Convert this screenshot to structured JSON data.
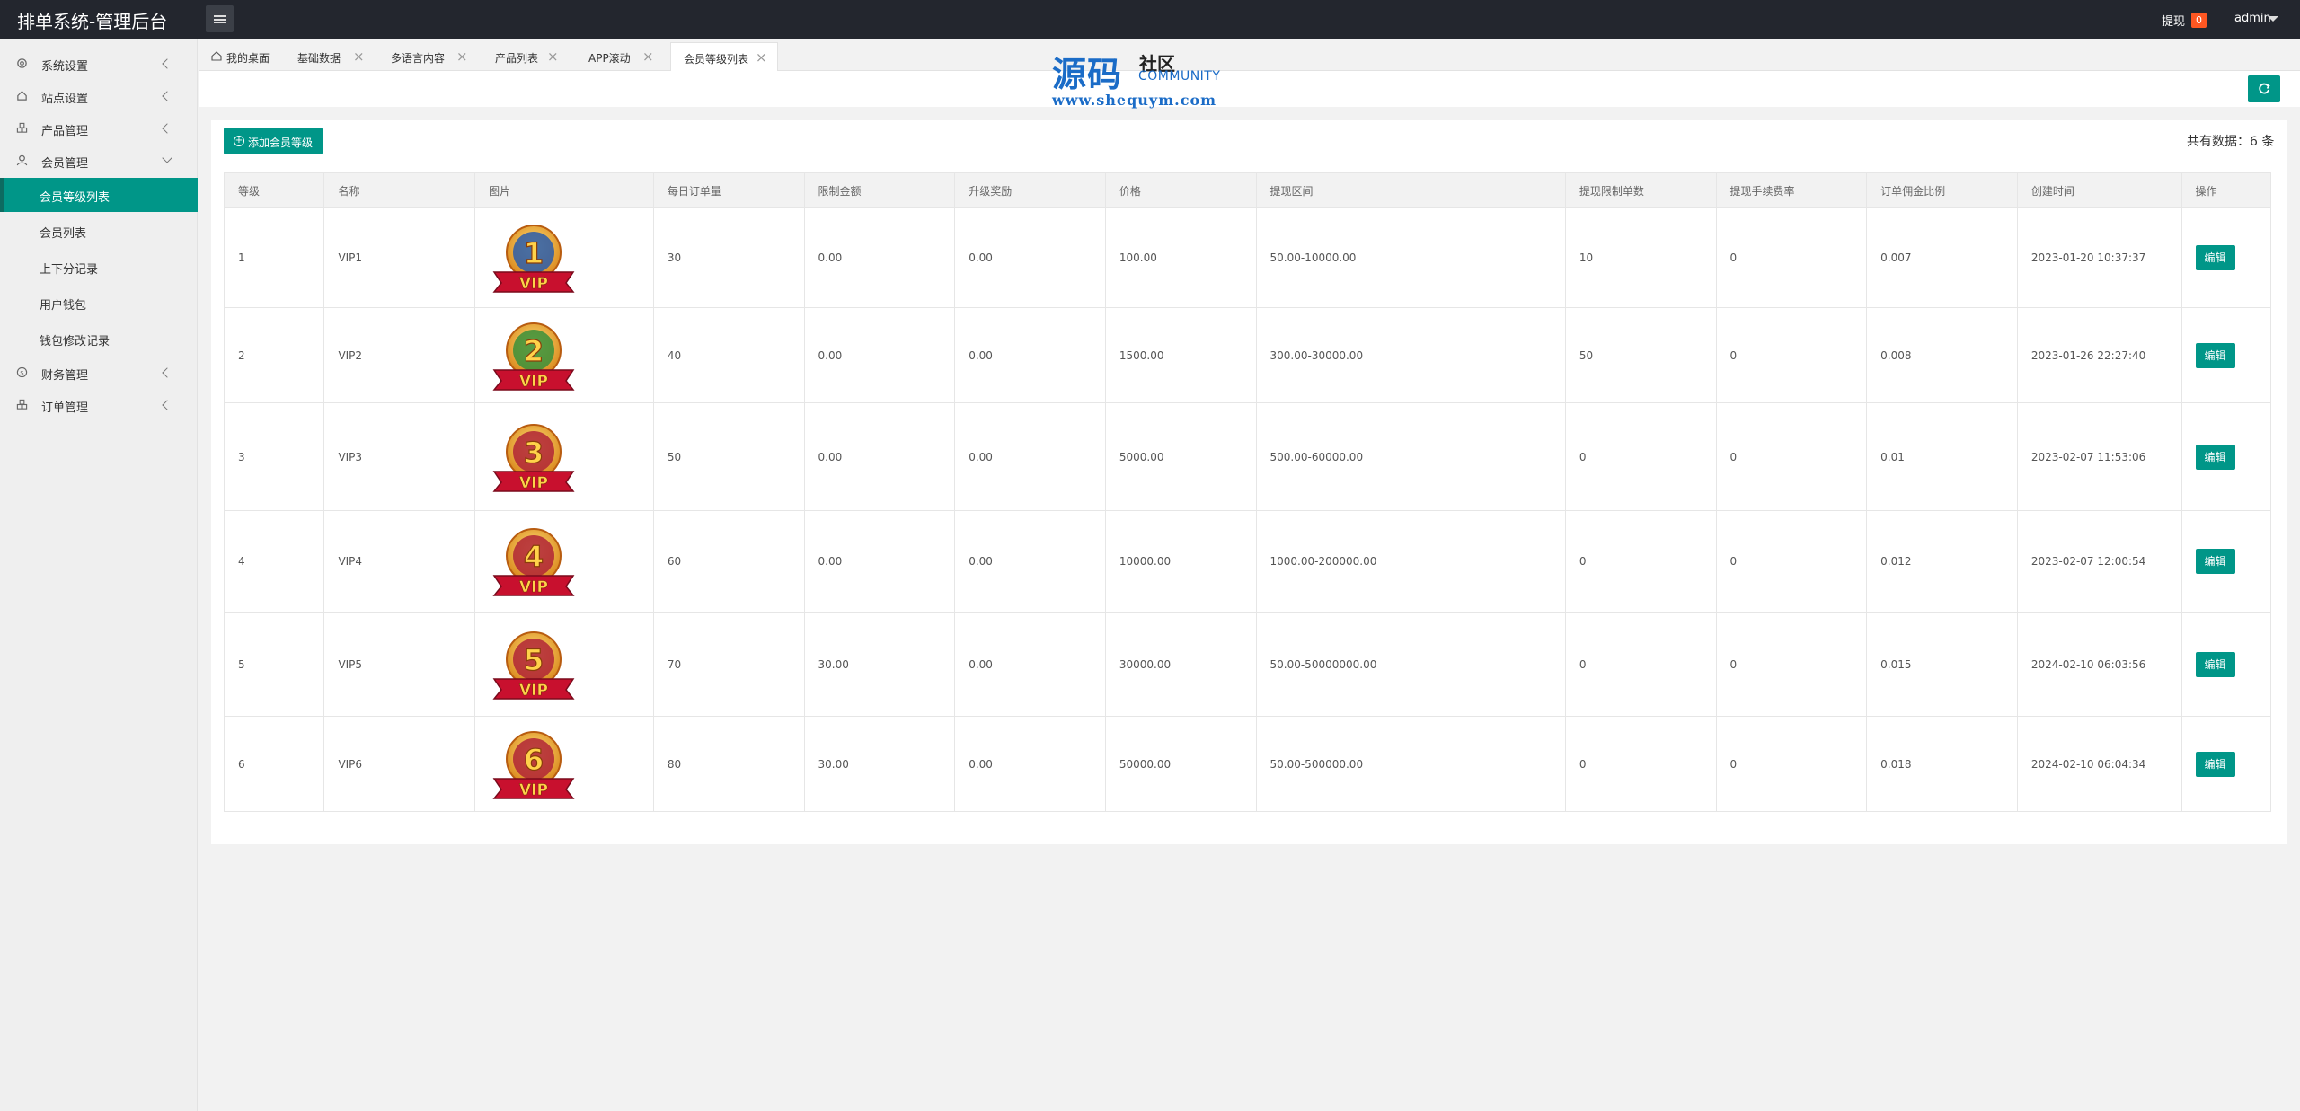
{
  "header": {
    "app_title": "排单系统-管理后台",
    "withdraw_label": "提现",
    "withdraw_badge": "0",
    "user_name": "admin"
  },
  "sidebar": {
    "items": [
      {
        "label": "系统设置",
        "icon": "gear-icon"
      },
      {
        "label": "站点设置",
        "icon": "home-icon"
      },
      {
        "label": "产品管理",
        "icon": "cubes-icon"
      },
      {
        "label": "会员管理",
        "icon": "user-icon"
      },
      {
        "label": "财务管理",
        "icon": "dollar-icon"
      },
      {
        "label": "订单管理",
        "icon": "cubes-icon"
      }
    ],
    "sub_items": [
      {
        "label": "会员等级列表"
      },
      {
        "label": "会员列表"
      },
      {
        "label": "上下分记录"
      },
      {
        "label": "用户钱包"
      },
      {
        "label": "钱包修改记录"
      }
    ]
  },
  "tabs": [
    {
      "label": "我的桌面"
    },
    {
      "label": "基础数据"
    },
    {
      "label": "多语言内容"
    },
    {
      "label": "产品列表"
    },
    {
      "label": "APP滚动"
    },
    {
      "label": "会员等级列表"
    }
  ],
  "watermark": {
    "title": "源码",
    "cn": "社区",
    "en": "COMMUNITY",
    "url": "www.shequym.com"
  },
  "toolbar": {
    "add_label": "添加会员等级",
    "count_label": "共有数据：6 条"
  },
  "table": {
    "headers": [
      "等级",
      "名称",
      "图片",
      "每日订单量",
      "限制金额",
      "升级奖励",
      "价格",
      "提现区间",
      "提现限制单数",
      "提现手续费率",
      "订单佣金比例",
      "创建时间",
      "操作"
    ],
    "edit_label": "编辑",
    "rows": [
      {
        "level": "1",
        "name": "VIP1",
        "badge": "1",
        "daily": "30",
        "limit": "0.00",
        "reward": "0.00",
        "price": "100.00",
        "range": "50.00-10000.00",
        "wlimit": "10",
        "fee": "0",
        "commission": "0.007",
        "created": "2023-01-20 10:37:37"
      },
      {
        "level": "2",
        "name": "VIP2",
        "badge": "2",
        "daily": "40",
        "limit": "0.00",
        "reward": "0.00",
        "price": "1500.00",
        "range": "300.00-30000.00",
        "wlimit": "50",
        "fee": "0",
        "commission": "0.008",
        "created": "2023-01-26 22:27:40"
      },
      {
        "level": "3",
        "name": "VIP3",
        "badge": "3",
        "daily": "50",
        "limit": "0.00",
        "reward": "0.00",
        "price": "5000.00",
        "range": "500.00-60000.00",
        "wlimit": "0",
        "fee": "0",
        "commission": "0.01",
        "created": "2023-02-07 11:53:06"
      },
      {
        "level": "4",
        "name": "VIP4",
        "badge": "4",
        "daily": "60",
        "limit": "0.00",
        "reward": "0.00",
        "price": "10000.00",
        "range": "1000.00-200000.00",
        "wlimit": "0",
        "fee": "0",
        "commission": "0.012",
        "created": "2023-02-07 12:00:54"
      },
      {
        "level": "5",
        "name": "VIP5",
        "badge": "5",
        "daily": "70",
        "limit": "30.00",
        "reward": "0.00",
        "price": "30000.00",
        "range": "50.00-50000000.00",
        "wlimit": "0",
        "fee": "0",
        "commission": "0.015",
        "created": "2024-02-10 06:03:56"
      },
      {
        "level": "6",
        "name": "VIP6",
        "badge": "6",
        "daily": "80",
        "limit": "30.00",
        "reward": "0.00",
        "price": "50000.00",
        "range": "50.00-500000.00",
        "wlimit": "0",
        "fee": "0",
        "commission": "0.018",
        "created": "2024-02-10 06:04:34"
      }
    ]
  },
  "colors": {
    "topbar": "#23262e",
    "accent": "#009688",
    "badge": "#ff5722"
  }
}
